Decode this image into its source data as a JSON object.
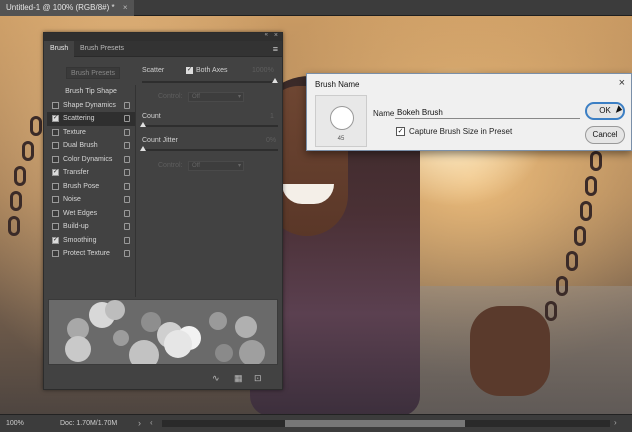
{
  "document": {
    "tab_title": "Untitled-1 @ 100% (RGB/8#) *",
    "tab_close": "×"
  },
  "status": {
    "zoom": "100%",
    "doc_info": "Doc: 1.70M/1.70M",
    "arrow": "›",
    "scroll_left": "‹",
    "scroll_right": "›"
  },
  "brush_panel": {
    "collapse": "«",
    "close": "×",
    "tabs": [
      {
        "label": "Brush"
      },
      {
        "label": "Brush Presets"
      }
    ],
    "menu_icon": "≡",
    "brush_presets_button": "Brush Presets",
    "options": [
      {
        "label": "Brush Tip Shape"
      },
      {
        "label": "Shape Dynamics",
        "checked": false
      },
      {
        "label": "Scattering",
        "checked": true
      },
      {
        "label": "Texture",
        "checked": false
      },
      {
        "label": "Dual Brush",
        "checked": false
      },
      {
        "label": "Color Dynamics",
        "checked": false
      },
      {
        "label": "Transfer",
        "checked": true
      },
      {
        "label": "Brush Pose",
        "checked": false
      },
      {
        "label": "Noise",
        "checked": false
      },
      {
        "label": "Wet Edges",
        "checked": false
      },
      {
        "label": "Build-up",
        "checked": false
      },
      {
        "label": "Smoothing",
        "checked": true
      },
      {
        "label": "Protect Texture",
        "checked": false
      }
    ],
    "check_mark": "✓",
    "settings": {
      "scatter_label": "Scatter",
      "both_axes_label": "Both Axes",
      "scatter_value": "1000%",
      "control_label": "Control:",
      "control_value": "Off",
      "count_label": "Count",
      "count_value": "1",
      "count_jitter_label": "Count Jitter",
      "count_jitter_value": "0%",
      "control2_label": "Control:",
      "control2_value": "Off",
      "caret": "▾"
    },
    "footer_icons": [
      "∿",
      "▦",
      "⊡"
    ]
  },
  "dialog": {
    "title": "Brush Name",
    "close": "×",
    "thumbnail_size": "45",
    "name_label": "Name:",
    "name_value": "Bokeh Brush",
    "capture_label": "Capture Brush Size in Preset",
    "capture_checked": true,
    "check_mark": "✓",
    "ok_label": "OK",
    "cancel_label": "Cancel"
  },
  "colors": {
    "panel_bg": "#424242",
    "canvas_bg": "#282828",
    "ok_border": "#3c7fc4",
    "dialog_bg": "#f0f0f0"
  }
}
